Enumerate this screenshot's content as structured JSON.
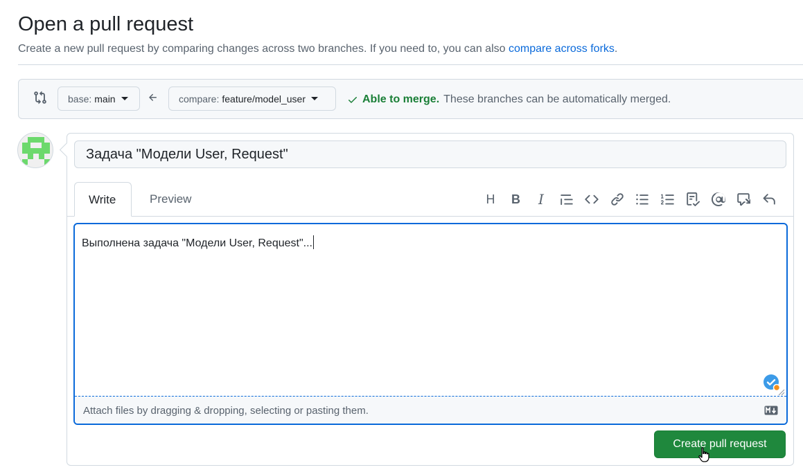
{
  "header": {
    "title": "Open a pull request",
    "subtitle": "Create a new pull request by comparing changes across two branches. If you need to, you can also",
    "subtitle_link": "compare across forks",
    "subtitle_end": "."
  },
  "compare": {
    "icon": "git-compare-icon",
    "base_label": "base:",
    "base_value": "main",
    "arrow_icon": "arrow-left-icon",
    "compare_label": "compare:",
    "compare_value": "feature/model_user",
    "merge_ok": "Able to merge.",
    "merge_message": "These branches can be automatically merged.",
    "merge_color": "#1a7f37"
  },
  "form": {
    "title_value": "Задача \"Модели User, Request\"",
    "tabs": [
      {
        "label": "Write",
        "active": true
      },
      {
        "label": "Preview",
        "active": false
      }
    ],
    "toolbar": {
      "heading": "H",
      "bold": "B",
      "italic": "I",
      "icons": [
        "heading-icon",
        "bold-icon",
        "italic-icon",
        "quote-icon",
        "code-icon",
        "link-icon",
        "unordered-list-icon",
        "ordered-list-icon",
        "task-list-icon",
        "mention-icon",
        "cross-reference-icon",
        "undo-icon"
      ]
    },
    "body_value": "Выполнена задача \"Модели User, Request\"...",
    "attach_hint": "Attach files by dragging & dropping, selecting or pasting them.",
    "markdown_icon": "markdown-icon",
    "submit_label": "Create pull request",
    "submit_color": "#1f883d",
    "accent_color": "#0969da"
  }
}
